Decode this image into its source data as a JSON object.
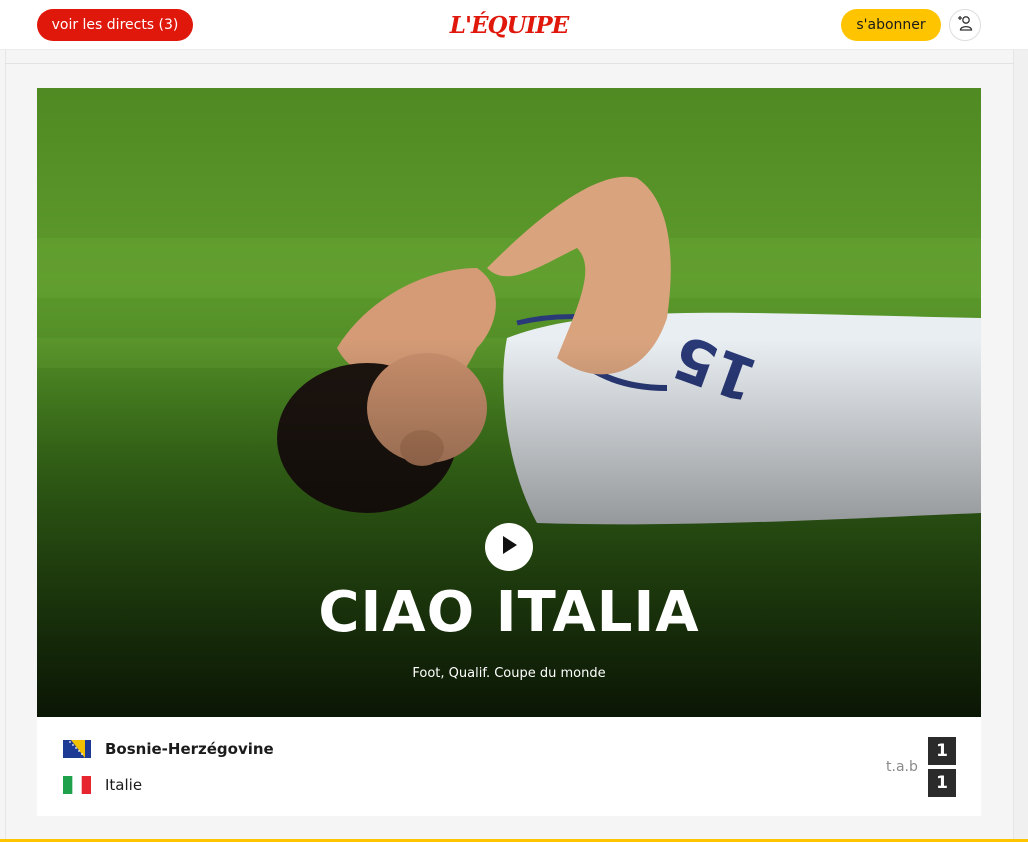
{
  "header": {
    "live_label": "voir les directs (3)",
    "logo_text": "L'ÉQUIPE",
    "subscribe_label": "s'abonner",
    "account_icon": "user-add-icon"
  },
  "hero": {
    "title": "CIAO ITALIA",
    "subtitle": "Foot, Qualif. Coupe du monde",
    "play_icon": "play-icon"
  },
  "match": {
    "team1": {
      "name": "Bosnie-Herzégovine",
      "score": "1"
    },
    "team2": {
      "name": "Italie",
      "score": "1"
    },
    "note": "t.a.b"
  },
  "colors": {
    "brand_red": "#e0180c",
    "accent_yellow": "#ffc400",
    "score_bg": "#2b2b2b"
  }
}
